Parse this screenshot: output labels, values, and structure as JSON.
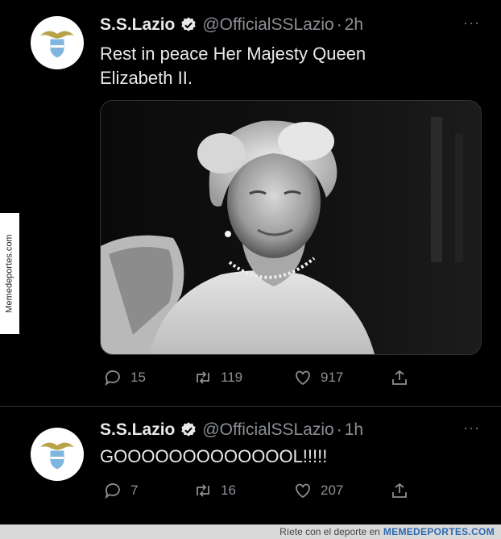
{
  "tweets": [
    {
      "name": "S.S.Lazio",
      "handle": "@OfficialSSLazio",
      "separator": "·",
      "time": "2h",
      "more": "···",
      "text_line1": "Rest in peace Her Majesty Queen",
      "text_line2": "Elizabeth II.",
      "replies": "15",
      "retweets": "119",
      "likes": "917"
    },
    {
      "name": "S.S.Lazio",
      "handle": "@OfficialSSLazio",
      "separator": "·",
      "time": "1h",
      "more": "···",
      "text_line1": "GOOOOOOOOOOOOOL!!!!!",
      "replies": "7",
      "retweets": "16",
      "likes": "207"
    }
  ],
  "watermark": {
    "side": "Memedeportes.com",
    "footer_text": "Ríete con el deporte en",
    "footer_brand": "MEMEDEPORTES.COM"
  },
  "colors": {
    "background": "#000000",
    "text": "#e7e9ea",
    "secondary": "#8b8f94",
    "lazio_blue": "#7fb6df"
  }
}
